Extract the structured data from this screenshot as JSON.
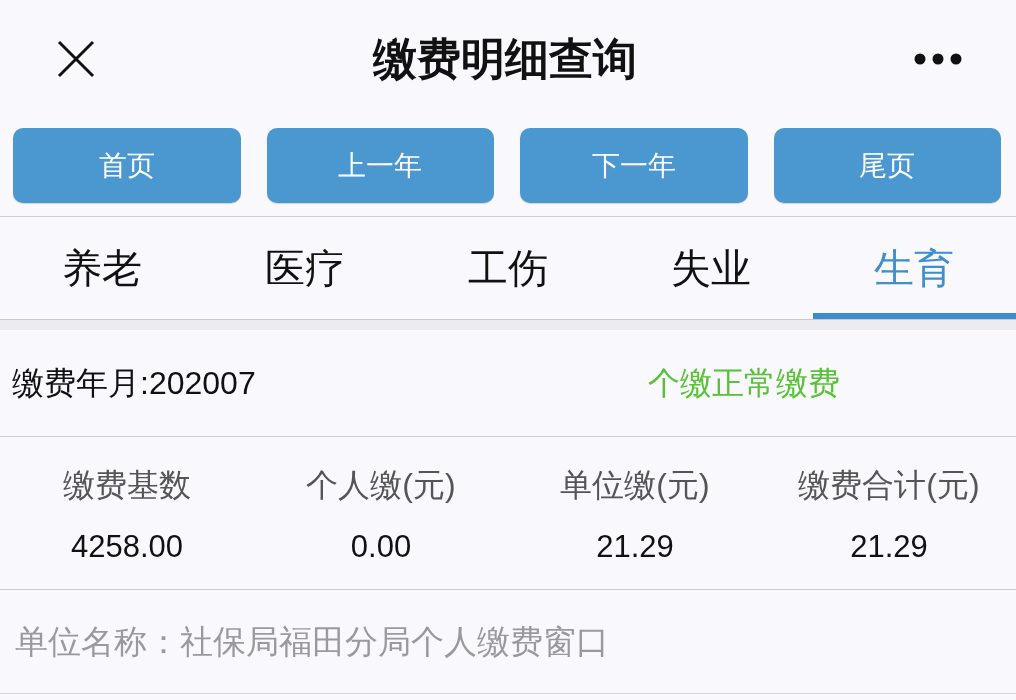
{
  "header": {
    "title": "缴费明细查询"
  },
  "nav_buttons": [
    "首页",
    "上一年",
    "下一年",
    "尾页"
  ],
  "tabs": [
    {
      "label": "养老",
      "selected": false
    },
    {
      "label": "医疗",
      "selected": false
    },
    {
      "label": "工伤",
      "selected": false
    },
    {
      "label": "失业",
      "selected": false
    },
    {
      "label": "生育",
      "selected": true
    }
  ],
  "record": {
    "period": "缴费年月:202007",
    "status": "个缴正常缴费",
    "columns": [
      "缴费基数",
      "个人缴(元)",
      "单位缴(元)",
      "缴费合计(元)"
    ],
    "values": [
      "4258.00",
      "0.00",
      "21.29",
      "21.29"
    ],
    "unit_name": "单位名称：社保局福田分局个人缴费窗口"
  }
}
